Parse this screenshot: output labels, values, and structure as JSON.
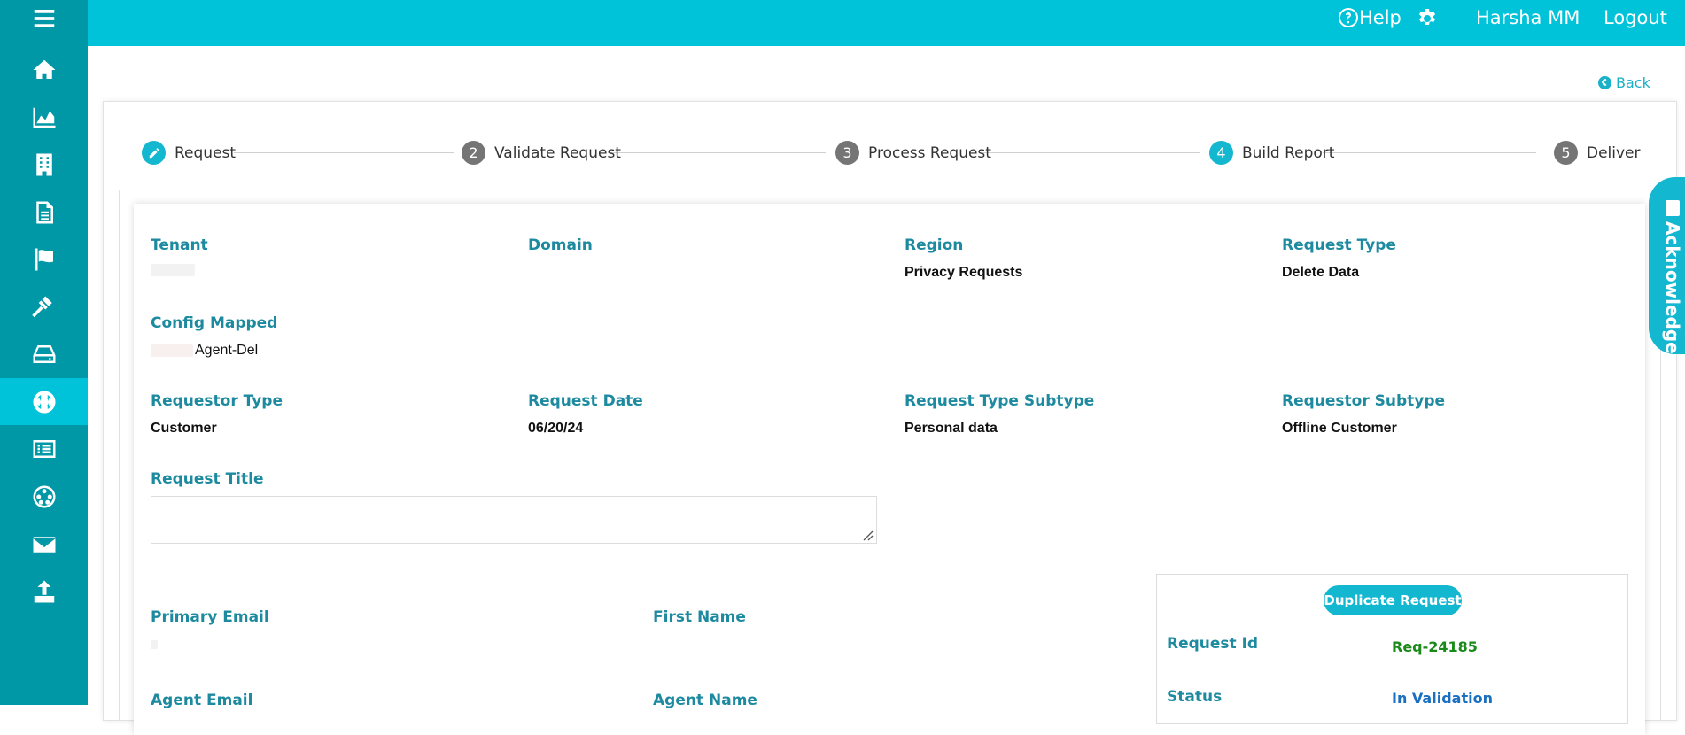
{
  "header": {
    "help_label": "Help",
    "user_name": "Harsha MM",
    "logout_label": "Logout"
  },
  "back_label": "Back",
  "stepper": {
    "steps": [
      {
        "number": "",
        "label": "Request"
      },
      {
        "number": "2",
        "label": "Validate Request"
      },
      {
        "number": "3",
        "label": "Process Request"
      },
      {
        "number": "4",
        "label": "Build Report"
      },
      {
        "number": "5",
        "label": "Deliver"
      }
    ]
  },
  "form": {
    "tenant_label": "Tenant",
    "domain_label": "Domain",
    "region_label": "Region",
    "region_value": "Privacy Requests",
    "request_type_label": "Request Type",
    "request_type_value": "Delete Data",
    "config_mapped_label": "Config Mapped",
    "config_mapped_value": "Agent-Del",
    "requestor_type_label": "Requestor Type",
    "requestor_type_value": "Customer",
    "request_date_label": "Request Date",
    "request_date_value": "06/20/24",
    "request_type_subtype_label": "Request Type Subtype",
    "request_type_subtype_value": "Personal data",
    "requestor_subtype_label": "Requestor Subtype",
    "requestor_subtype_value": "Offline Customer",
    "request_title_label": "Request Title",
    "request_title_value": "",
    "primary_email_label": "Primary Email",
    "first_name_label": "First Name",
    "agent_email_label": "Agent Email",
    "agent_name_label": "Agent Name"
  },
  "info": {
    "duplicate_button": "Duplicate Request",
    "request_id_label": "Request Id",
    "request_id_value": "Req-24185",
    "status_label": "Status",
    "status_value": "In Validation"
  },
  "acknowledge_label": "Acknowledge",
  "colors": {
    "sidebar": "#0097a7",
    "topbar": "#00c3d9",
    "accent": "#14b7d0",
    "label": "#1d8aa0"
  }
}
